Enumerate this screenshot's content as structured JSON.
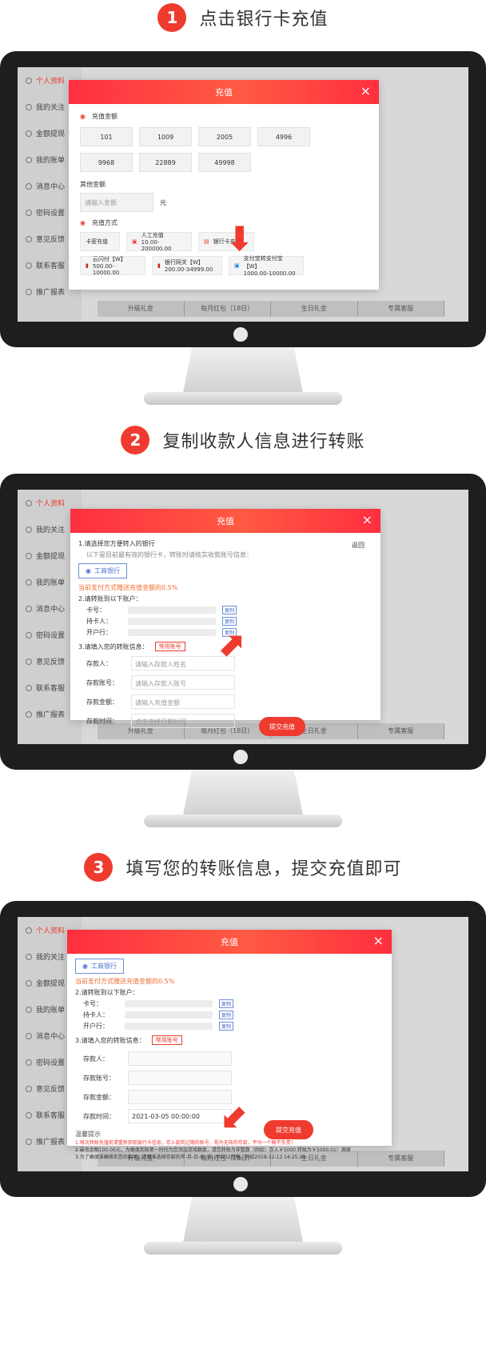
{
  "steps": [
    {
      "number": "1",
      "title": "点击银行卡充值"
    },
    {
      "number": "2",
      "title": "复制收款人信息进行转账"
    },
    {
      "number": "3",
      "title": "填写您的转账信息，提交充值即可"
    }
  ],
  "sidebar": [
    "个人资料",
    "我的关注",
    "金额提现",
    "我的账单",
    "消息中心",
    "密码设置",
    "意见反馈",
    "联系客服",
    "推广报表"
  ],
  "bottom_tabs": [
    "升级礼金",
    "每月红包（18日）",
    "生日礼金",
    "专属客服"
  ],
  "modal_title": "充值",
  "screen1": {
    "amount_label": "充值金额",
    "amounts": [
      "101",
      "1009",
      "2005",
      "4996",
      "9968",
      "22889",
      "49998"
    ],
    "other_amount_label": "其他金额",
    "other_amount_placeholder": "请输入金额",
    "unit": "元",
    "method_label": "充值方式",
    "methods": [
      {
        "name": "卡密充值",
        "limit": ""
      },
      {
        "name": "人工充值",
        "limit": "10.00-200000.00"
      },
      {
        "name": "银行卡充值",
        "limit": ""
      },
      {
        "name": "云闪付【W】",
        "limit": "500.00-10000.00"
      },
      {
        "name": "银行网关【W】",
        "limit": "200.00-34999.00"
      },
      {
        "name": "支付宝转支付宝【W】",
        "limit": "1000.00-10000.00"
      }
    ]
  },
  "screen2": {
    "title1": "1.请选择您方便转入的银行",
    "hint1": "以下是目前最有效的银行卡，转账时请核实收款账号信息：",
    "back": "返回",
    "bank": "工商银行",
    "bonus": "当前支付方式赠送充值金额的0.5%",
    "title2": "2.请转账到以下账户：",
    "card_label": "卡号：",
    "holder_label": "持卡人：",
    "branch_label": "开户行：",
    "copy": "复制",
    "title3": "3.请填入您的转账信息：",
    "common_account": "常用账号",
    "depositor_label": "存款人：",
    "depositor_placeholder": "请输入存款人姓名",
    "account_label": "存款账号：",
    "account_placeholder": "请输入存款人账号",
    "amount_label": "存款金额：",
    "amount_placeholder": "请输入充值金额",
    "time_label": "存款时间：",
    "time_placeholder": "点击选择日期时间",
    "submit": "提交充值"
  },
  "screen3": {
    "time_value": "2021-03-05 00:00:00",
    "submit": "提交充值",
    "tip_title": "温馨提示",
    "tip1": "1.每次转账充值前请重新获取银行卡信息，存入款到过期的账号，视为无效的存款，平台一个概不负责！",
    "tip2": "2.最低金额100.00元，为确保到账第一时间为您添加游戏额度，请您转账为非整数（例如：存入￥5000 转账为￥5000.01）谢谢",
    "tip3": "3.为了确保准确核实您的款项，请精准选择存款的年-月-日-时-分，秒可以忽略。例如2018-12-12 14:25:20"
  }
}
